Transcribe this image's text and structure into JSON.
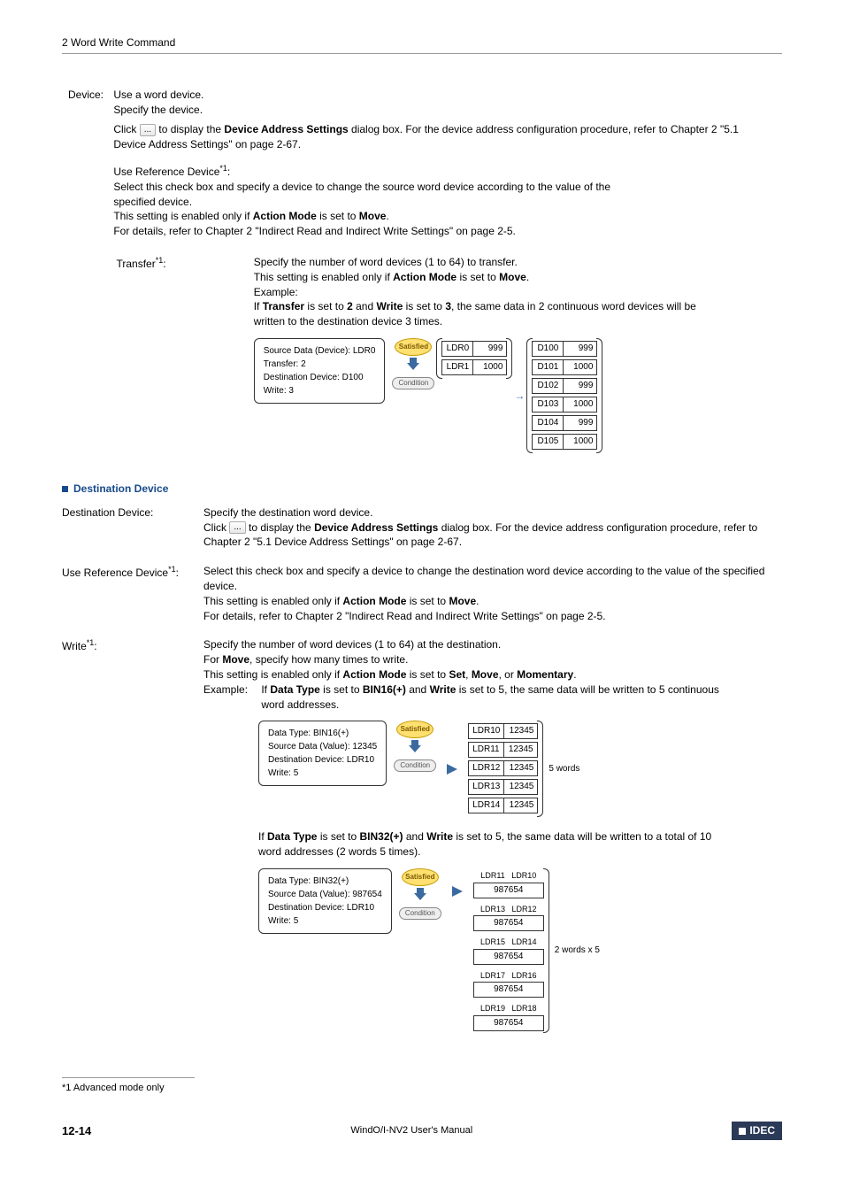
{
  "header": {
    "title": "2 Word Write Command"
  },
  "device": {
    "label": "Device:",
    "line1": "Use a word device.",
    "line2": "Specify the device.",
    "click_prefix": "Click ",
    "click_btn": "...",
    "click_suffix_a": " to display the ",
    "click_bold": "Device Address Settings",
    "click_suffix_b": " dialog box. For the device address configuration procedure, refer to Chapter 2 \"5.1 Device Address Settings\" on page 2-67.",
    "useref_label_a": "Use Reference Device",
    "useref_sup": "*1",
    "useref_label_b": ":",
    "useref_body_1": "Select this check box and specify a device to change the source word device according to the value of the specified device.",
    "useref_body_2a": "This setting is enabled only if ",
    "useref_body_2b": "Action Mode",
    "useref_body_2c": " is set to ",
    "useref_body_2d": "Move",
    "useref_body_2e": ".",
    "useref_body_3": "For details, refer to Chapter 2 \"Indirect Read and Indirect Write Settings\" on page 2-5.",
    "transfer_label_a": "Transfer",
    "transfer_sup": "*1",
    "transfer_label_b": ":",
    "transfer_body_1": "Specify the number of word devices (1 to 64) to transfer.",
    "transfer_body_2a": "This setting is enabled only if ",
    "transfer_body_2b": "Action Mode",
    "transfer_body_2c": " is set to ",
    "transfer_body_2d": "Move",
    "transfer_body_2e": ".",
    "transfer_ex_label": "Example:",
    "transfer_ex_a": "If ",
    "transfer_ex_b": "Transfer",
    "transfer_ex_c": " is set to ",
    "transfer_ex_d": "2",
    "transfer_ex_e": " and ",
    "transfer_ex_f": "Write",
    "transfer_ex_g": " is set to ",
    "transfer_ex_h": "3",
    "transfer_ex_i": ", the same data in 2 continuous word devices will be written to the destination device 3 times."
  },
  "diagram1": {
    "box_l1": "Source Data (Device): LDR0",
    "box_l2": "Transfer: 2",
    "box_l3": "Destination Device: D100",
    "box_l4": "Write: 3",
    "satisfied": "Satisfied",
    "condition": "Condition",
    "src": [
      {
        "name": "LDR0",
        "val": "999"
      },
      {
        "name": "LDR1",
        "val": "1000"
      }
    ],
    "dst": [
      {
        "name": "D100",
        "val": "999"
      },
      {
        "name": "D101",
        "val": "1000"
      },
      {
        "name": "D102",
        "val": "999"
      },
      {
        "name": "D103",
        "val": "1000"
      },
      {
        "name": "D104",
        "val": "999"
      },
      {
        "name": "D105",
        "val": "1000"
      }
    ]
  },
  "dest_heading": "Destination Device",
  "dest_device": {
    "label": "Destination Device:",
    "l1": "Specify the destination word device.",
    "click_prefix": "Click ",
    "click_btn": "...",
    "click_suffix_a": " to display the ",
    "click_bold": "Device Address Settings",
    "click_suffix_b": " dialog box. For the device address configuration procedure, refer to Chapter 2 \"5.1 Device Address Settings\" on page 2-67."
  },
  "dest_useref": {
    "label_a": "Use Reference Device",
    "sup": "*1",
    "label_b": ":",
    "l1": "Select this check box and specify a device to change the destination word device according to the value of the specified device.",
    "l2a": "This setting is enabled only if ",
    "l2b": "Action Mode",
    "l2c": " is set to ",
    "l2d": "Move",
    "l2e": ".",
    "l3": "For details, refer to Chapter 2 \"Indirect Read and Indirect Write Settings\" on page 2-5."
  },
  "dest_write": {
    "label_a": "Write",
    "sup": "*1",
    "label_b": ":",
    "l1": "Specify the number of word devices (1 to 64) at the destination.",
    "l2a": "For ",
    "l2b": "Move",
    "l2c": ", specify how many times to write.",
    "l3a": "This setting is enabled only if ",
    "l3b": "Action Mode",
    "l3c": " is set to ",
    "l3d": "Set",
    "l3e": ", ",
    "l3f": "Move",
    "l3g": ", or ",
    "l3h": "Momentary",
    "l3i": ".",
    "ex_label": "Example:",
    "ex1a": "If ",
    "ex1b": "Data Type",
    "ex1c": " is set to ",
    "ex1d": "BIN16(+)",
    "ex1e": " and ",
    "ex1f": "Write",
    "ex1g": " is set to 5, the same data will be written to 5 continuous word addresses."
  },
  "diagram2": {
    "box_l1": "Data Type: BIN16(+)",
    "box_l2": "Source Data (Value): 12345",
    "box_l3": "Destination Device: LDR10",
    "box_l4": "Write: 5",
    "satisfied": "Satisfied",
    "condition": "Condition",
    "rows": [
      {
        "name": "LDR10",
        "val": "12345"
      },
      {
        "name": "LDR11",
        "val": "12345"
      },
      {
        "name": "LDR12",
        "val": "12345"
      },
      {
        "name": "LDR13",
        "val": "12345"
      },
      {
        "name": "LDR14",
        "val": "12345"
      }
    ],
    "note": "5 words"
  },
  "example2_intro": {
    "a": "If ",
    "b": "Data Type",
    "c": " is set to ",
    "d": "BIN32(+)",
    "e": " and ",
    "f": "Write",
    "g": " is set to 5, the same data will be written to a total of 10 word addresses (2 words 5 times)."
  },
  "diagram3": {
    "box_l1": "Data Type: BIN32(+)",
    "box_l2": "Source Data (Value): 987654",
    "box_l3": "Destination Device: LDR10",
    "box_l4": "Write: 5",
    "satisfied": "Satisfied",
    "condition": "Condition",
    "rows": [
      {
        "hi": "LDR11",
        "lo": "LDR10",
        "val": "987654"
      },
      {
        "hi": "LDR13",
        "lo": "LDR12",
        "val": "987654"
      },
      {
        "hi": "LDR15",
        "lo": "LDR14",
        "val": "987654"
      },
      {
        "hi": "LDR17",
        "lo": "LDR16",
        "val": "987654"
      },
      {
        "hi": "LDR19",
        "lo": "LDR18",
        "val": "987654"
      }
    ],
    "note": "2 words x 5"
  },
  "footnote": "*1  Advanced mode only",
  "footer": {
    "page": "12-14",
    "center": "WindO/I-NV2 User's Manual",
    "brand": "IDEC"
  }
}
